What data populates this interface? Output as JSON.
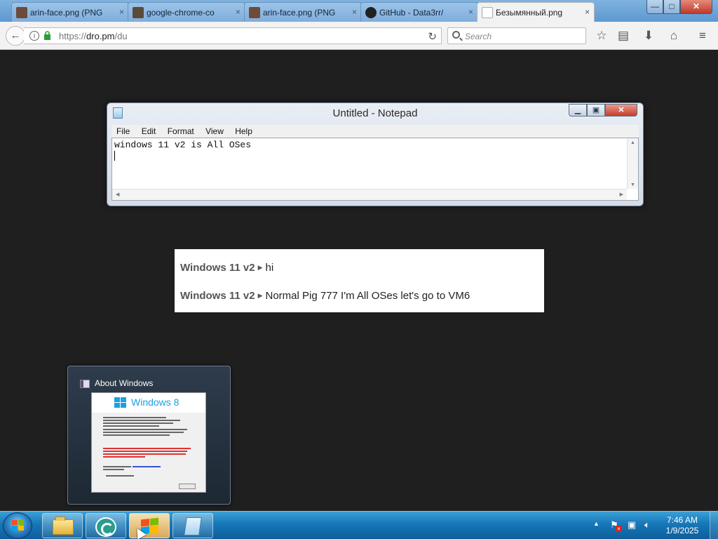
{
  "browser": {
    "tabs": [
      {
        "title": "arin-face.png (PNG",
        "close": "×",
        "favicon_color": "#6d4b3a"
      },
      {
        "title": "google-chrome-co",
        "close": "×",
        "favicon_color": "#5a4a3a"
      },
      {
        "title": "arin-face.png (PNG",
        "close": "×",
        "favicon_color": "#6d4b3a"
      },
      {
        "title": "GitHub - Data3rr/",
        "close": "×",
        "favicon_color": "#222222"
      },
      {
        "title": "Безымянный.png",
        "close": "×",
        "favicon_color": "#ffffff"
      }
    ],
    "window_controls": {
      "minimize": "—",
      "maximize": "□",
      "close": "✕"
    },
    "back_icon": "←",
    "url": {
      "scheme": "https://",
      "host": "dro.pm",
      "path": "/du"
    },
    "reload_icon": "↻",
    "search_placeholder": "Search",
    "toolbar_icons": {
      "bookmark": "☆",
      "reader": "▤",
      "download": "⬇",
      "home": "⌂",
      "menu": "≡"
    }
  },
  "notepad": {
    "title": "Untitled - Notepad",
    "controls": {
      "minimize": "▁",
      "maximize": "▣",
      "close": "✕"
    },
    "menu": [
      "File",
      "Edit",
      "Format",
      "View",
      "Help"
    ],
    "content": "windows 11 v2 is All OSes"
  },
  "chat": {
    "arrow": "▶",
    "messages": [
      {
        "sender": "Windows 11 v2",
        "text": "hi"
      },
      {
        "sender": "Windows 11 v2",
        "text": "Normal Pig 777 I'm All OSes let's go to VM6"
      }
    ]
  },
  "thumbnail": {
    "title": "About Windows",
    "banner_text": "Windows 8"
  },
  "taskbar": {
    "tray_chevron": "▲",
    "clock_time": "7:46 AM",
    "clock_date": "1/9/2025",
    "colors": {
      "accent": "#1677b8"
    }
  }
}
